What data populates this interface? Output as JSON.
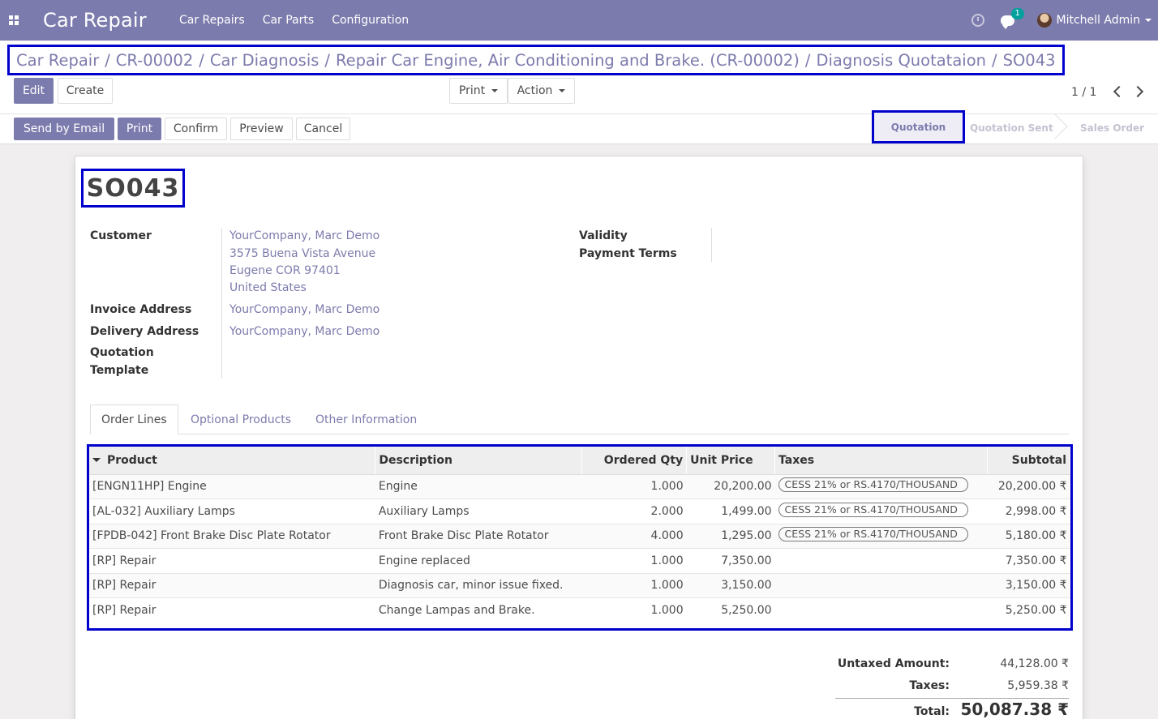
{
  "navbar": {
    "brand": "Car Repair",
    "menu": [
      "Car Repairs",
      "Car Parts",
      "Configuration"
    ],
    "chat_count": "1",
    "user": "Mitchell Admin"
  },
  "breadcrumb": [
    "Car Repair",
    "CR-00002",
    "Car Diagnosis",
    "Repair Car Engine, Air Conditioning and Brake. (CR-00002)",
    "Diagnosis Quotataion",
    "SO043"
  ],
  "toolbar": {
    "edit": "Edit",
    "create": "Create",
    "print": "Print",
    "action": "Action",
    "pager": "1 / 1"
  },
  "header_buttons": {
    "send_email": "Send by Email",
    "print": "Print",
    "confirm": "Confirm",
    "preview": "Preview",
    "cancel": "Cancel"
  },
  "statusbar": {
    "current": "Quotation",
    "steps": [
      "Quotation Sent",
      "Sales Order"
    ]
  },
  "form": {
    "name": "SO043",
    "customer_label": "Customer",
    "customer_lines": [
      "YourCompany, Marc Demo",
      "3575 Buena Vista Avenue",
      "Eugene COR 97401",
      "United States"
    ],
    "invoice_label": "Invoice Address",
    "invoice_value": "YourCompany, Marc Demo",
    "delivery_label": "Delivery Address",
    "delivery_value": "YourCompany, Marc Demo",
    "template_label_1": "Quotation",
    "template_label_2": "Template",
    "validity_label": "Validity",
    "payment_terms_label": "Payment Terms"
  },
  "tabs": [
    "Order Lines",
    "Optional Products",
    "Other Information"
  ],
  "order_lines": {
    "columns": [
      "Product",
      "Description",
      "Ordered Qty",
      "Unit Price",
      "Taxes",
      "Subtotal"
    ],
    "rows": [
      {
        "product": "[ENGN11HP] Engine",
        "description": "Engine",
        "qty": "1.000",
        "price": "20,200.00",
        "tax": "CESS 21% or RS.4170/THOUSAND",
        "subtotal": "20,200.00 ₹"
      },
      {
        "product": "[AL-032] Auxiliary Lamps",
        "description": "Auxiliary Lamps",
        "qty": "2.000",
        "price": "1,499.00",
        "tax": "CESS 21% or RS.4170/THOUSAND",
        "subtotal": "2,998.00 ₹"
      },
      {
        "product": "[FPDB-042] Front Brake Disc Plate Rotator",
        "description": "Front Brake Disc Plate Rotator",
        "qty": "4.000",
        "price": "1,295.00",
        "tax": "CESS 21% or RS.4170/THOUSAND",
        "subtotal": "5,180.00 ₹"
      },
      {
        "product": "[RP] Repair",
        "description": "Engine replaced",
        "qty": "1.000",
        "price": "7,350.00",
        "tax": "",
        "subtotal": "7,350.00 ₹"
      },
      {
        "product": "[RP] Repair",
        "description": "Diagnosis car, minor issue fixed.",
        "qty": "1.000",
        "price": "3,150.00",
        "tax": "",
        "subtotal": "3,150.00 ₹"
      },
      {
        "product": "[RP] Repair",
        "description": "Change Lampas and Brake.",
        "qty": "1.000",
        "price": "5,250.00",
        "tax": "",
        "subtotal": "5,250.00 ₹"
      }
    ]
  },
  "totals": {
    "untaxed_label": "Untaxed Amount:",
    "untaxed_value": "44,128.00 ₹",
    "taxes_label": "Taxes:",
    "taxes_value": "5,959.38 ₹",
    "total_label": "Total:",
    "total_value": "50,087.38 ₹"
  },
  "colors": {
    "brand": "#7c7bad",
    "highlight_box": "#0000cc"
  }
}
